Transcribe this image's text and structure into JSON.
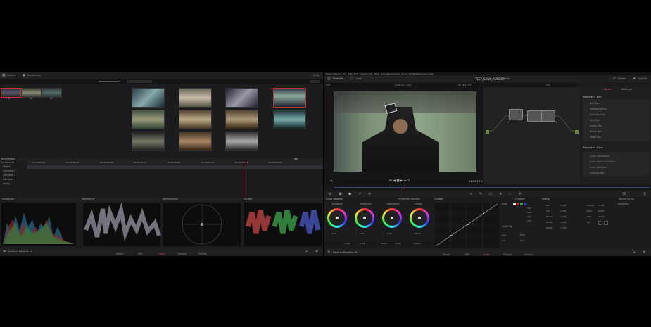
{
  "left_window": {
    "top_bar": {
      "gallery_label": "Gallery",
      "keyframes_label": "Keyframes",
      "stills_label": "Stills"
    },
    "strip_clips": [
      "01",
      "02",
      "03"
    ],
    "timeline": {
      "label": "Keyframes",
      "tracks": [
        "Master",
        "Corrector 1",
        "Corrector 2",
        "Corrector 3",
        "Sizing"
      ],
      "timecodes": [
        "01:00:01:12",
        "01:00:02:00",
        "01:00:03:00",
        "01:00:04:00",
        "01:00:05:00",
        "01:00:06:00",
        "01:00:07:00",
        "01:00:08:00",
        "01:00:09:00"
      ]
    },
    "scopes": {
      "histogram": "Histogram",
      "waveform": "Waveform",
      "vectorscope": "Vectorscope",
      "parade": "Parade"
    },
    "bottom_bar": {
      "app_name": "DaVinci Resolve 14",
      "pages": [
        "Media",
        "Edit",
        "Color",
        "Fairlight",
        "Deliver"
      ],
      "active_page": "Color"
    }
  },
  "right_window": {
    "menu": [
      "DaVinci Resolve",
      "File",
      "Edit",
      "Trim",
      "Timeline",
      "Clip",
      "Mark",
      "View",
      "Playback",
      "Color",
      "Fusion",
      "Fairlight",
      "Workspace",
      "Help"
    ],
    "project_title": "TEST_SONY_RENDER",
    "project_sub": "Edited",
    "top_tabs": {
      "timeline": "Timeline",
      "clips": "Clips",
      "nodes": "Nodes",
      "openfx": "OpenFX"
    },
    "viewer": {
      "timeline_name": "Timeline 1 copy",
      "timecode": "01:00:17:03",
      "zoom": "25%",
      "clip_label": "Clip"
    },
    "library": {
      "tabs": [
        "Library",
        "Settings"
      ],
      "section1": "ResolveFX Blur",
      "section1_items": [
        "Box Blur",
        "Directional Blur",
        "Gaussian Blur",
        "Lens Blur",
        "Mosaic Blur",
        "Radial Blur",
        "Zoom Blur"
      ],
      "section2": "ResolveFX Color",
      "section2_items": [
        "Color Compressor",
        "Color Space Transform",
        "Color Stabilizer",
        "Contrast Pop"
      ]
    },
    "color_wheels": {
      "title": "Color Wheels",
      "mode": "Primaries Wheels",
      "wheels": [
        "Shadows",
        "Midtones",
        "Highlights",
        "Offset"
      ],
      "values": [
        "0.00",
        "0.00",
        "0.00",
        "25.00"
      ],
      "bottom_params": {
        "contrast": "1.000",
        "pivot": "0.435",
        "sat": "50.00",
        "hue": "50.00",
        "lum_mix": "100.00"
      }
    },
    "curves": {
      "title": "Curves",
      "custom": "Custom",
      "edit_label": "Edit",
      "soft_clip": "Soft Clip",
      "values": [
        "100",
        "100",
        "100",
        "100"
      ],
      "low": "Low",
      "high": "High",
      "ls": "L.S.",
      "hs": "H.S."
    },
    "sizing": {
      "title": "Sizing",
      "input_sizing": "Input Sizing",
      "fields": [
        "Pan",
        "Tilt",
        "Zoom",
        "Rotate",
        "Width"
      ],
      "values": [
        "0.000",
        "0.000",
        "1.000",
        "0.000",
        "1.000"
      ],
      "fields2": [
        "Height",
        "Pitch",
        "Yaw",
        "Flip"
      ],
      "values2": [
        "1.000",
        "0.000",
        "0.000",
        ""
      ],
      "blanking": "Blanking"
    },
    "bottom_bar": {
      "app_name": "DaVinci Resolve 14",
      "pages": [
        "Media",
        "Edit",
        "Color",
        "Fairlight",
        "Deliver"
      ],
      "active_page": "Color"
    }
  },
  "colors": {
    "accent": "#e05050",
    "panel": "#1c1c1e"
  }
}
